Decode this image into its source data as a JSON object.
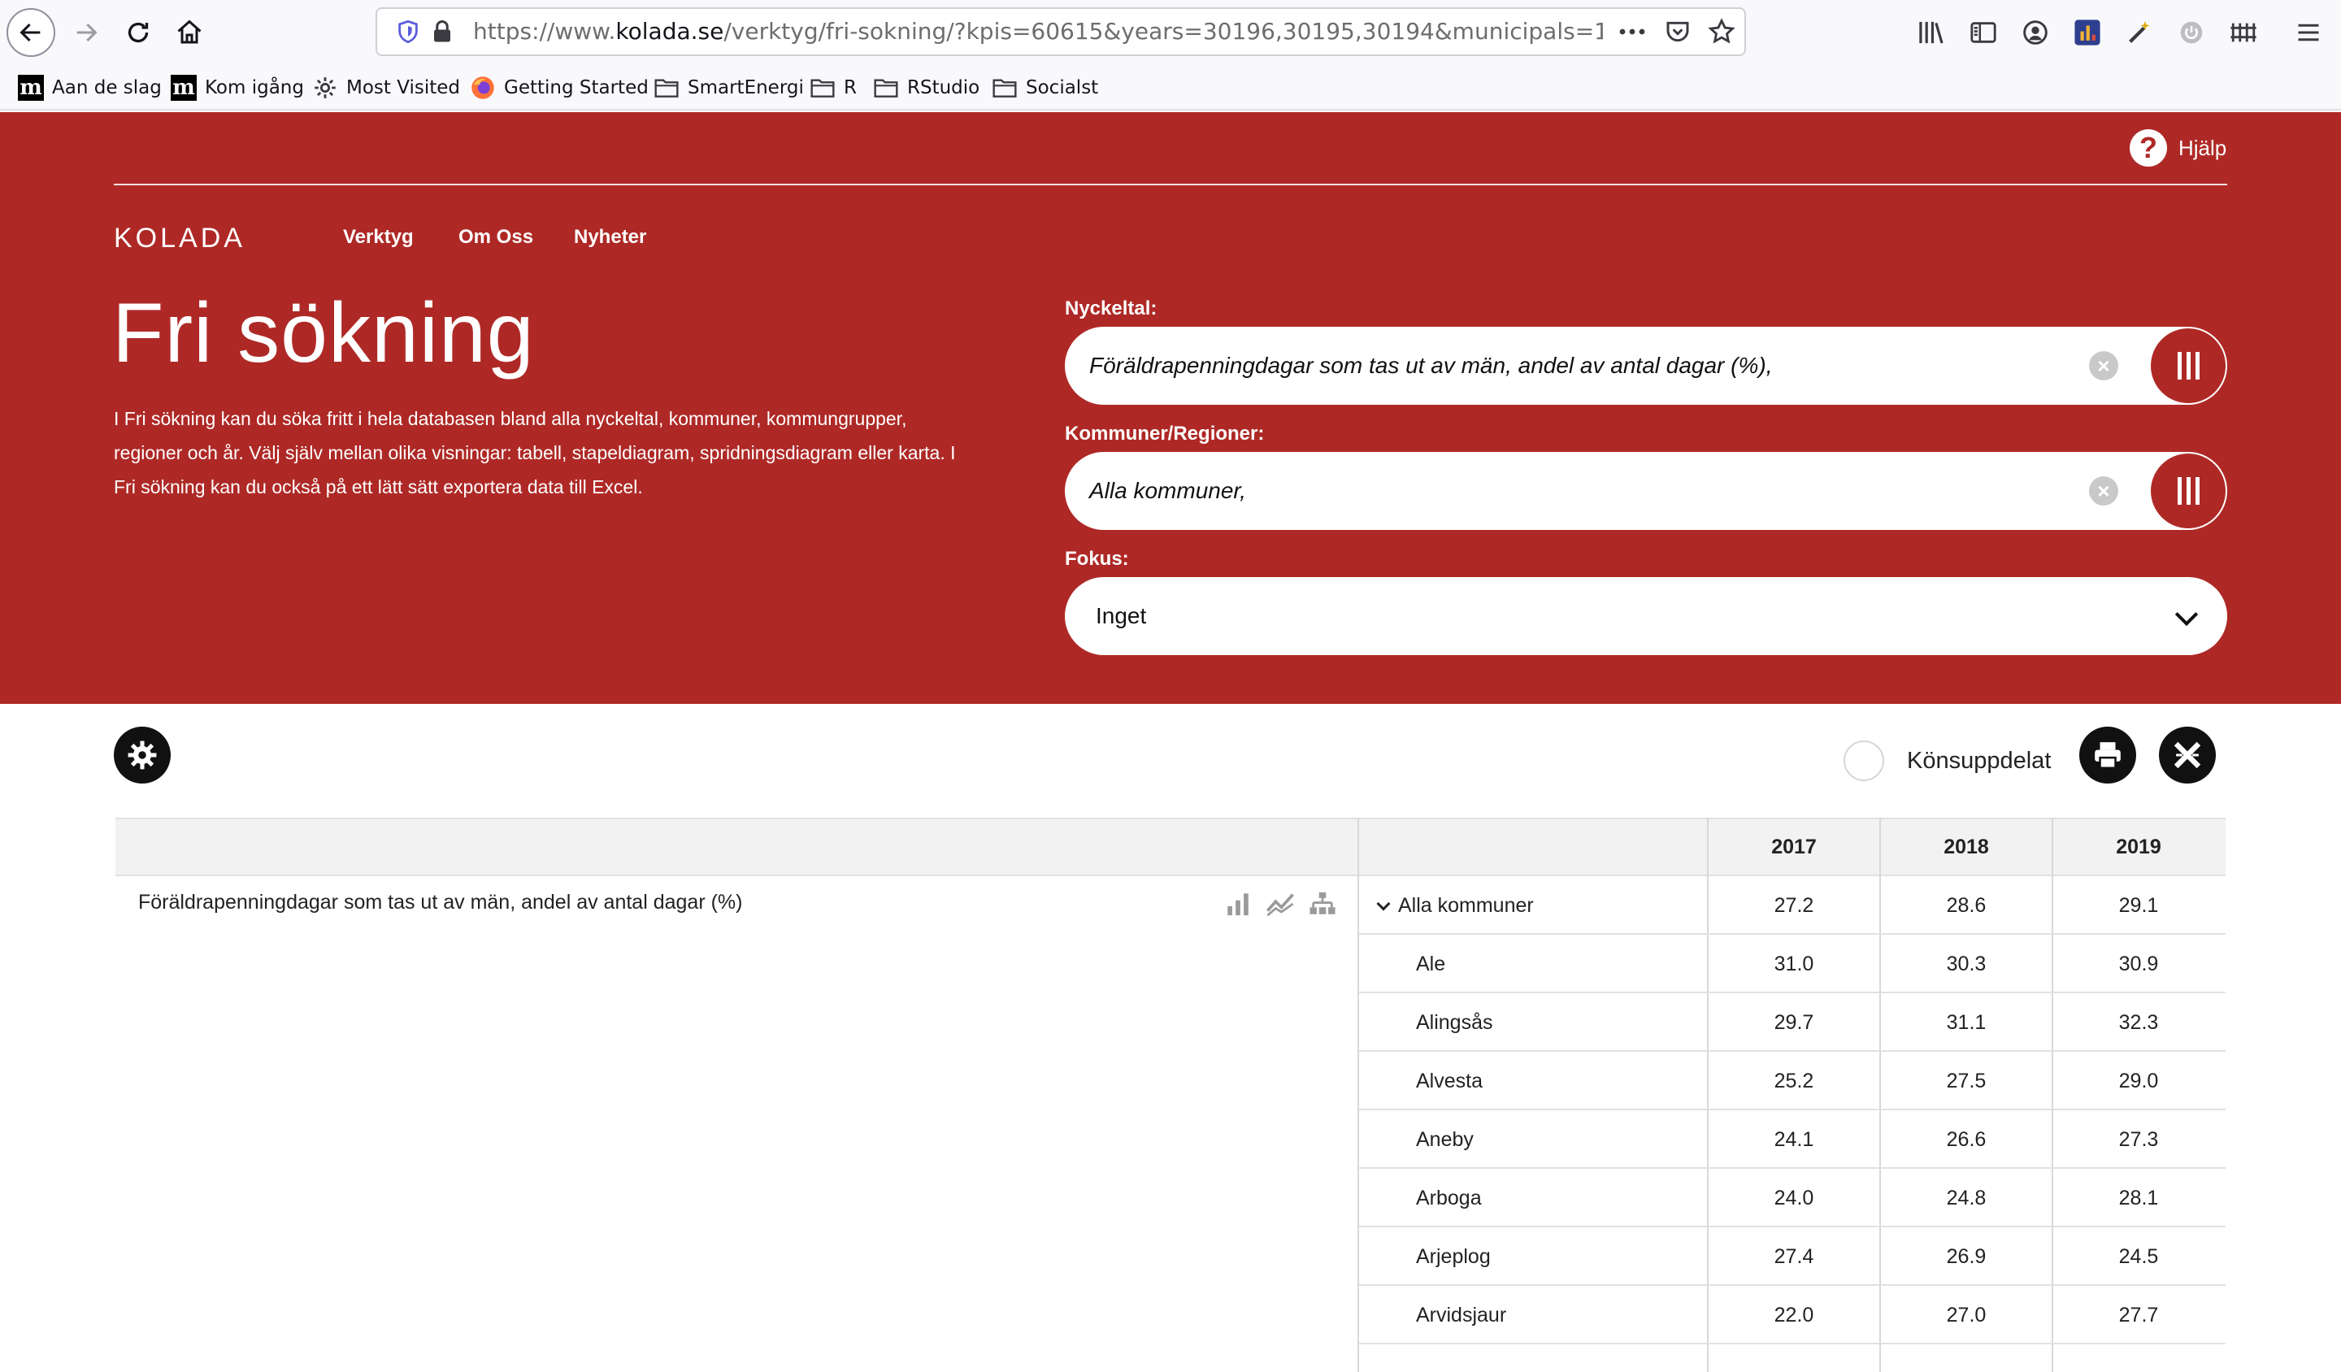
{
  "browser": {
    "url_prefix": "https://www.",
    "url_domain": "kolada.se",
    "url_path": "/verktyg/fri-sokning/?kpis=60615&years=30196,30195,30194&municipals=146551&rov",
    "bookmarks": [
      {
        "label": "Aan de slag",
        "icon": "m-logo"
      },
      {
        "label": "Kom igång",
        "icon": "m-logo"
      },
      {
        "label": "Most Visited",
        "icon": "gear-icon"
      },
      {
        "label": "Getting Started",
        "icon": "firefox-icon"
      },
      {
        "label": "SmartEnergi",
        "icon": "folder-icon"
      },
      {
        "label": "R",
        "icon": "folder-icon"
      },
      {
        "label": "RStudio",
        "icon": "folder-icon"
      },
      {
        "label": "Socialst",
        "icon": "folder-icon"
      }
    ]
  },
  "header": {
    "help_label": "Hjälp",
    "logo": "KOLADA",
    "nav": [
      "Verktyg",
      "Om Oss",
      "Nyheter"
    ],
    "title": "Fri sökning",
    "intro": "I Fri sökning kan du söka fritt i hela databasen bland alla nyckeltal, kommuner, kommungrupper, regioner och år. Välj själv mellan olika visningar: tabell, stapeldiagram, spridningsdiagram eller karta. I Fri sökning kan du också på ett lätt sätt exportera data till Excel."
  },
  "filters": {
    "kpi_label": "Nyckeltal:",
    "kpi_value": "Föräldrapenningdagar som tas ut av män, andel av antal dagar (%),",
    "muni_label": "Kommuner/Regioner:",
    "muni_value": "Alla kommuner,",
    "focus_label": "Fokus:",
    "focus_value": "Inget"
  },
  "colors": {
    "brand_red": "#ae2926"
  },
  "controls": {
    "gender_split_label": "Könsuppdelat"
  },
  "table": {
    "years": [
      "2017",
      "2018",
      "2019"
    ],
    "kpi": "Föräldrapenningdagar som tas ut av män, andel av antal dagar (%)",
    "rows": [
      {
        "name": "Alla kommuner",
        "values": [
          "27.2",
          "28.6",
          "29.1"
        ],
        "group": true
      },
      {
        "name": "Ale",
        "values": [
          "31.0",
          "30.3",
          "30.9"
        ]
      },
      {
        "name": "Alingsås",
        "values": [
          "29.7",
          "31.1",
          "32.3"
        ]
      },
      {
        "name": "Alvesta",
        "values": [
          "25.2",
          "27.5",
          "29.0"
        ]
      },
      {
        "name": "Aneby",
        "values": [
          "24.1",
          "26.6",
          "27.3"
        ]
      },
      {
        "name": "Arboga",
        "values": [
          "24.0",
          "24.8",
          "28.1"
        ]
      },
      {
        "name": "Arjeplog",
        "values": [
          "27.4",
          "26.9",
          "24.5"
        ]
      },
      {
        "name": "Arvidsjaur",
        "values": [
          "22.0",
          "27.0",
          "27.7"
        ]
      }
    ]
  }
}
